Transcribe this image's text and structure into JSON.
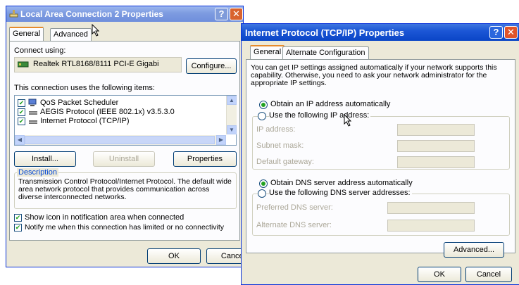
{
  "dialog1": {
    "title": "Local Area Connection 2 Properties",
    "tabs": [
      "General",
      "Advanced"
    ],
    "connect_using_label": "Connect using:",
    "adapter_name": "Realtek RTL8168/8111 PCI-E Gigabi",
    "configure_button": "Configure...",
    "items_label": "This connection uses the following items:",
    "items": [
      {
        "label": "QoS Packet Scheduler",
        "checked": true
      },
      {
        "label": "AEGIS Protocol (IEEE 802.1x) v3.5.3.0",
        "checked": true
      },
      {
        "label": "Internet Protocol (TCP/IP)",
        "checked": true
      }
    ],
    "install_button": "Install...",
    "uninstall_button": "Uninstall",
    "properties_button": "Properties",
    "description_title": "Description",
    "description_text": "Transmission Control Protocol/Internet Protocol. The default wide area network protocol that provides communication across diverse interconnected networks.",
    "show_icon_label": "Show icon in notification area when connected",
    "notify_label": "Notify me when this connection has limited or no connectivity",
    "ok_button": "OK",
    "cancel_button": "Cancel"
  },
  "dialog2": {
    "title": "Internet Protocol (TCP/IP) Properties",
    "tabs": [
      "General",
      "Alternate Configuration"
    ],
    "intro_text": "You can get IP settings assigned automatically if your network supports this capability. Otherwise, you need to ask your network administrator for the appropriate IP settings.",
    "obtain_ip_label": "Obtain an IP address automatically",
    "use_ip_label": "Use the following IP address:",
    "ip_address_label": "IP address:",
    "subnet_mask_label": "Subnet mask:",
    "default_gateway_label": "Default gateway:",
    "obtain_dns_label": "Obtain DNS server address automatically",
    "use_dns_label": "Use the following DNS server addresses:",
    "preferred_dns_label": "Preferred DNS server:",
    "alternate_dns_label": "Alternate DNS server:",
    "advanced_button": "Advanced...",
    "ok_button": "OK",
    "cancel_button": "Cancel"
  },
  "colors": {
    "title_active": "#0a45c6",
    "title_inactive": "#7d9be0",
    "dialog_bg": "#ece9d8",
    "accent_tab": "#e68b2c"
  },
  "icons": {
    "help": "?",
    "close": "✕"
  }
}
